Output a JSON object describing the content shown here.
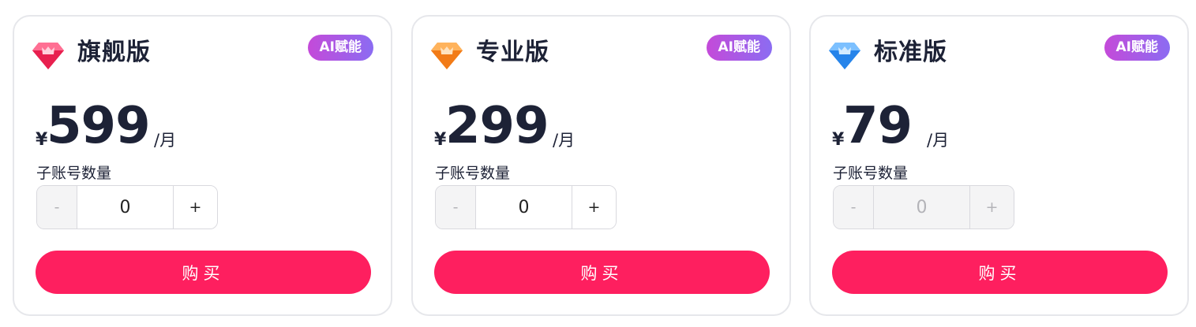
{
  "plans": [
    {
      "name": "旗舰版",
      "badge": "AI赋能",
      "currency": "¥",
      "price": "599",
      "period": "/月",
      "sub_account_label": "子账号数量",
      "quantity": "0",
      "minus_label": "-",
      "plus_label": "+",
      "buy_label": "购买",
      "icon": "ruby-gem-icon",
      "gem_color": "#f4356a",
      "disabled": false
    },
    {
      "name": "专业版",
      "badge": "AI赋能",
      "currency": "¥",
      "price": "299",
      "period": "/月",
      "sub_account_label": "子账号数量",
      "quantity": "0",
      "minus_label": "-",
      "plus_label": "+",
      "buy_label": "购买",
      "icon": "orange-gem-icon",
      "gem_color": "#f7902c",
      "disabled": false
    },
    {
      "name": "标准版",
      "badge": "AI赋能",
      "currency": "¥",
      "price": "79",
      "period": "/月",
      "sub_account_label": "子账号数量",
      "quantity": "0",
      "minus_label": "-",
      "plus_label": "+",
      "buy_label": "购买",
      "icon": "blue-gem-icon",
      "gem_color": "#3f9bf5",
      "disabled": true
    }
  ],
  "colors": {
    "buy_button": "#fe1f5f",
    "badge_gradient_start": "#c44ad9",
    "badge_gradient_end": "#8b6cf2",
    "text_primary": "#1d2236"
  }
}
